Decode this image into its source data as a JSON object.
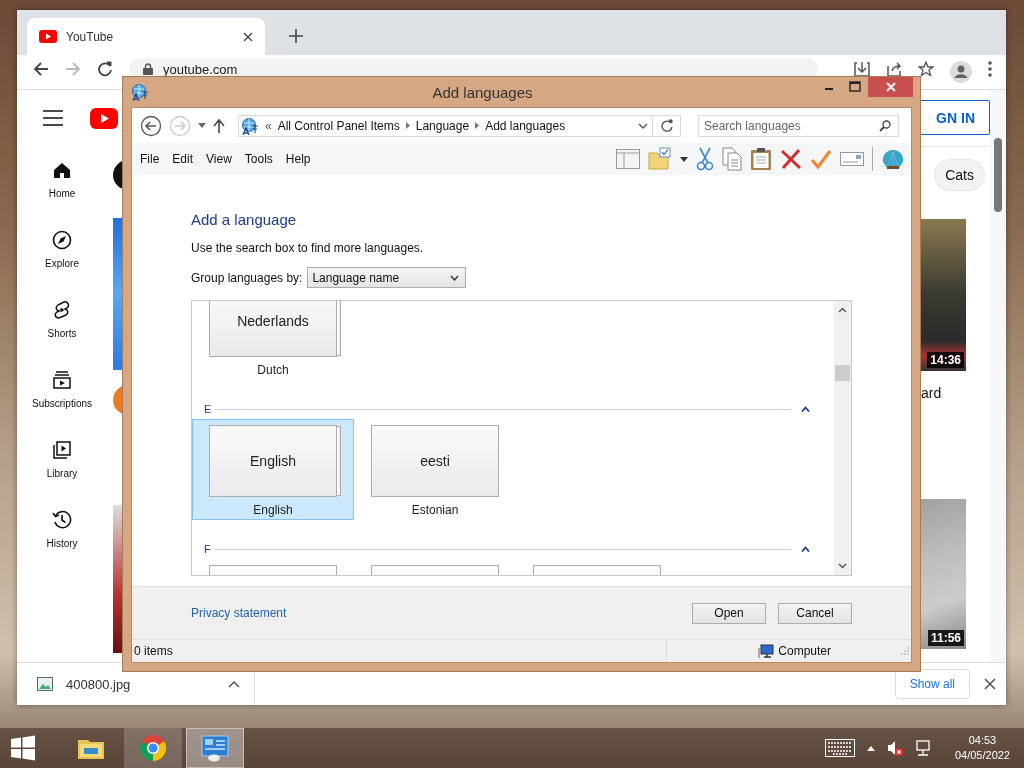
{
  "browser": {
    "tab": {
      "title": "YouTube"
    },
    "address": "youtube.com",
    "sidebar": {
      "items": [
        {
          "label": "Home"
        },
        {
          "label": "Explore"
        },
        {
          "label": "Shorts"
        },
        {
          "label": "Subscriptions"
        },
        {
          "label": "Library"
        },
        {
          "label": "History"
        }
      ]
    },
    "sign_in": "GN IN",
    "chips": [
      {
        "label": "Cats"
      }
    ],
    "videos": [
      {
        "duration": "14:36",
        "title": "ard"
      },
      {
        "duration": "11:56"
      }
    ],
    "downloads": {
      "file": "400800.jpg",
      "show_all": "Show all"
    }
  },
  "dialog": {
    "title": "Add languages",
    "breadcrumb_overflow": "«",
    "breadcrumb": [
      "All Control Panel Items",
      "Language",
      "Add languages"
    ],
    "search": {
      "placeholder": "Search languages"
    },
    "menu": [
      "File",
      "Edit",
      "View",
      "Tools",
      "Help"
    ],
    "heading": "Add a language",
    "hint": "Use the search box to find more languages.",
    "group_by": {
      "label": "Group languages by:",
      "value": "Language name"
    },
    "groups": [
      {
        "tiles": [
          {
            "kind": "language",
            "native": "Nederlands",
            "name": "Dutch",
            "stacked": true,
            "selected": false
          }
        ]
      },
      {
        "letter": "E",
        "expanded": true,
        "tiles": [
          {
            "kind": "language",
            "native": "English",
            "name": "English",
            "stacked": true,
            "selected": true
          },
          {
            "kind": "language",
            "native": "eesti",
            "name": "Estonian",
            "stacked": false,
            "selected": false
          }
        ]
      },
      {
        "letter": "F",
        "expanded": true,
        "tiles": [
          {
            "kind": "cut"
          },
          {
            "kind": "cut"
          },
          {
            "kind": "cut"
          }
        ]
      }
    ],
    "privacy": "Privacy statement",
    "buttons": [
      "Open",
      "Cancel"
    ],
    "status": {
      "items": "0 items",
      "location": "Computer"
    }
  },
  "taskbar": {
    "apps": [
      {
        "running": false,
        "selected": false
      },
      {
        "running": true,
        "selected": false
      },
      {
        "running": true,
        "selected": true
      }
    ],
    "time": "04:53",
    "date": "04/05/2022"
  }
}
